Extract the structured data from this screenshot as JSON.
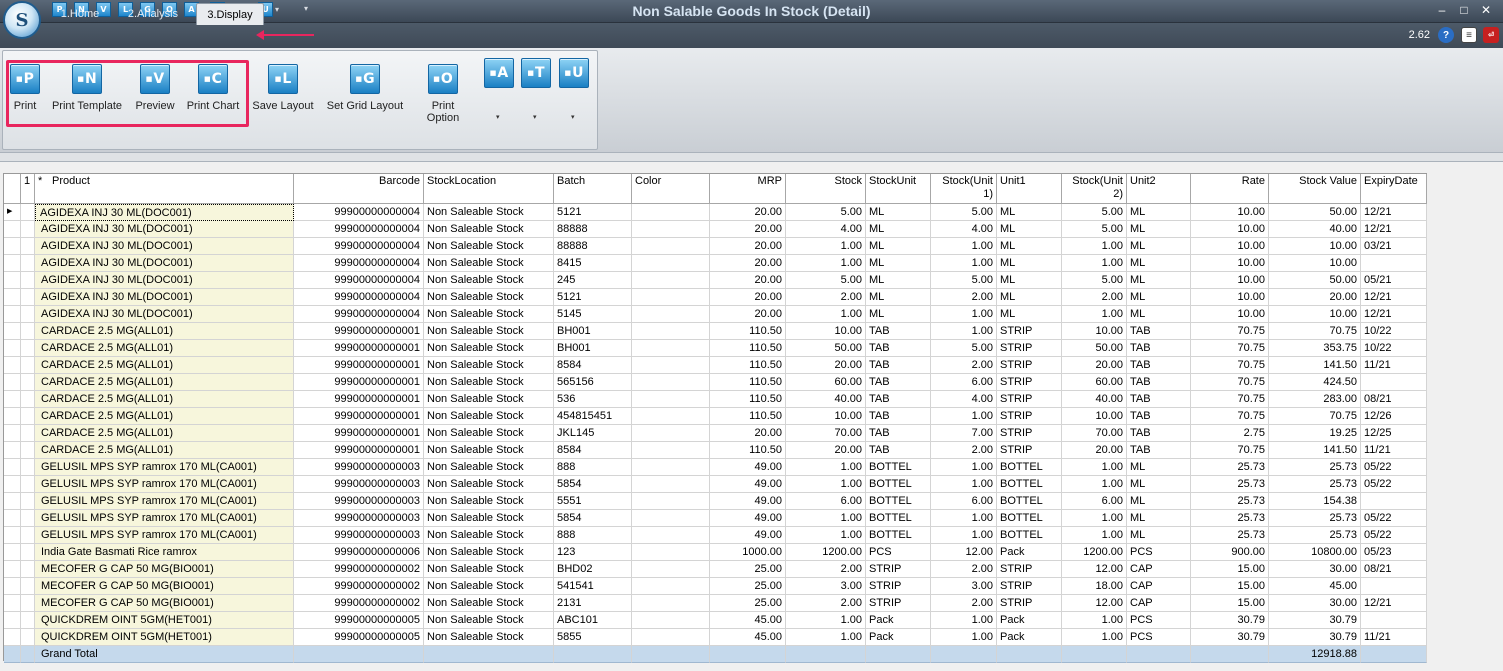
{
  "window": {
    "title": "Non Salable Goods In Stock (Detail)",
    "version": "2.62",
    "logo_letter": "S"
  },
  "quick_access": [
    {
      "letter": "P",
      "icon": "print-icon"
    },
    {
      "letter": "N",
      "icon": "template-icon"
    },
    {
      "letter": "V",
      "icon": "preview-icon"
    },
    {
      "letter": "L",
      "icon": "layout-icon"
    },
    {
      "letter": "G",
      "icon": "grid-icon"
    },
    {
      "letter": "O",
      "icon": "option-icon"
    },
    {
      "letter": "A",
      "icon": "a-icon"
    },
    {
      "letter": "T",
      "icon": "t-icon"
    },
    {
      "letter": "U",
      "icon": "u-icon"
    }
  ],
  "tabs": [
    "1.Home",
    "2.Analysis",
    "3.Display"
  ],
  "ribbon": [
    {
      "letter": "P",
      "label": "Print",
      "icon": "print-icon"
    },
    {
      "letter": "N",
      "label": "Print Template",
      "icon": "print-template-icon"
    },
    {
      "letter": "V",
      "label": "Preview",
      "icon": "preview-icon"
    },
    {
      "letter": "C",
      "label": "Print Chart",
      "icon": "print-chart-icon"
    },
    {
      "letter": "L",
      "label": "Save Layout",
      "icon": "save-layout-icon"
    },
    {
      "letter": "G",
      "label": "Set Grid Layout",
      "icon": "grid-layout-icon"
    },
    {
      "letter": "O",
      "label": "Print Option",
      "icon": "print-option-icon"
    },
    {
      "letter": "A",
      "label": "",
      "icon": "a-dropdown-icon"
    },
    {
      "letter": "T",
      "label": "",
      "icon": "t-dropdown-icon"
    },
    {
      "letter": "U",
      "label": "",
      "icon": "u-dropdown-icon"
    }
  ],
  "grid": {
    "corner": "1",
    "star": "*",
    "columns": [
      "Product",
      "Barcode",
      "StockLocation",
      "Batch",
      "Color",
      "MRP",
      "Stock",
      "StockUnit",
      "Stock(Unit 1)",
      "Unit1",
      "Stock(Unit 2)",
      "Unit2",
      "Rate",
      "Stock Value",
      "ExpiryDate"
    ],
    "rows": [
      [
        "AGIDEXA INJ 30 ML(DOC001)",
        "99900000000004",
        "Non Saleable Stock",
        "5121",
        "",
        "20.00",
        "5.00",
        "ML",
        "5.00",
        "ML",
        "5.00",
        "ML",
        "10.00",
        "50.00",
        "12/21"
      ],
      [
        "AGIDEXA INJ 30 ML(DOC001)",
        "99900000000004",
        "Non Saleable Stock",
        "88888",
        "",
        "20.00",
        "4.00",
        "ML",
        "4.00",
        "ML",
        "5.00",
        "ML",
        "10.00",
        "40.00",
        "12/21"
      ],
      [
        "AGIDEXA INJ 30 ML(DOC001)",
        "99900000000004",
        "Non Saleable Stock",
        "88888",
        "",
        "20.00",
        "1.00",
        "ML",
        "1.00",
        "ML",
        "1.00",
        "ML",
        "10.00",
        "10.00",
        "03/21"
      ],
      [
        "AGIDEXA INJ 30 ML(DOC001)",
        "99900000000004",
        "Non Saleable Stock",
        "8415",
        "",
        "20.00",
        "1.00",
        "ML",
        "1.00",
        "ML",
        "1.00",
        "ML",
        "10.00",
        "10.00",
        ""
      ],
      [
        "AGIDEXA INJ 30 ML(DOC001)",
        "99900000000004",
        "Non Saleable Stock",
        "245",
        "",
        "20.00",
        "5.00",
        "ML",
        "5.00",
        "ML",
        "5.00",
        "ML",
        "10.00",
        "50.00",
        "05/21"
      ],
      [
        "AGIDEXA INJ 30 ML(DOC001)",
        "99900000000004",
        "Non Saleable Stock",
        "5121",
        "",
        "20.00",
        "2.00",
        "ML",
        "2.00",
        "ML",
        "2.00",
        "ML",
        "10.00",
        "20.00",
        "12/21"
      ],
      [
        "AGIDEXA INJ 30 ML(DOC001)",
        "99900000000004",
        "Non Saleable Stock",
        "5145",
        "",
        "20.00",
        "1.00",
        "ML",
        "1.00",
        "ML",
        "1.00",
        "ML",
        "10.00",
        "10.00",
        "12/21"
      ],
      [
        "CARDACE 2.5 MG(ALL01)",
        "99900000000001",
        "Non Saleable Stock",
        "BH001",
        "",
        "110.50",
        "10.00",
        "TAB",
        "1.00",
        "STRIP",
        "10.00",
        "TAB",
        "70.75",
        "70.75",
        "10/22"
      ],
      [
        "CARDACE 2.5 MG(ALL01)",
        "99900000000001",
        "Non Saleable Stock",
        "BH001",
        "",
        "110.50",
        "50.00",
        "TAB",
        "5.00",
        "STRIP",
        "50.00",
        "TAB",
        "70.75",
        "353.75",
        "10/22"
      ],
      [
        "CARDACE 2.5 MG(ALL01)",
        "99900000000001",
        "Non Saleable Stock",
        "8584",
        "",
        "110.50",
        "20.00",
        "TAB",
        "2.00",
        "STRIP",
        "20.00",
        "TAB",
        "70.75",
        "141.50",
        "11/21"
      ],
      [
        "CARDACE 2.5 MG(ALL01)",
        "99900000000001",
        "Non Saleable Stock",
        "565156",
        "",
        "110.50",
        "60.00",
        "TAB",
        "6.00",
        "STRIP",
        "60.00",
        "TAB",
        "70.75",
        "424.50",
        ""
      ],
      [
        "CARDACE 2.5 MG(ALL01)",
        "99900000000001",
        "Non Saleable Stock",
        "536",
        "",
        "110.50",
        "40.00",
        "TAB",
        "4.00",
        "STRIP",
        "40.00",
        "TAB",
        "70.75",
        "283.00",
        "08/21"
      ],
      [
        "CARDACE 2.5 MG(ALL01)",
        "99900000000001",
        "Non Saleable Stock",
        "454815451",
        "",
        "110.50",
        "10.00",
        "TAB",
        "1.00",
        "STRIP",
        "10.00",
        "TAB",
        "70.75",
        "70.75",
        "12/26"
      ],
      [
        "CARDACE 2.5 MG(ALL01)",
        "99900000000001",
        "Non Saleable Stock",
        "JKL145",
        "",
        "20.00",
        "70.00",
        "TAB",
        "7.00",
        "STRIP",
        "70.00",
        "TAB",
        "2.75",
        "19.25",
        "12/25"
      ],
      [
        "CARDACE 2.5 MG(ALL01)",
        "99900000000001",
        "Non Saleable Stock",
        "8584",
        "",
        "110.50",
        "20.00",
        "TAB",
        "2.00",
        "STRIP",
        "20.00",
        "TAB",
        "70.75",
        "141.50",
        "11/21"
      ],
      [
        "GELUSIL MPS SYP ramrox 170 ML(CA001)",
        "99900000000003",
        "Non Saleable Stock",
        "888",
        "",
        "49.00",
        "1.00",
        "BOTTEL",
        "1.00",
        "BOTTEL",
        "1.00",
        "ML",
        "25.73",
        "25.73",
        "05/22"
      ],
      [
        "GELUSIL MPS SYP ramrox 170 ML(CA001)",
        "99900000000003",
        "Non Saleable Stock",
        "5854",
        "",
        "49.00",
        "1.00",
        "BOTTEL",
        "1.00",
        "BOTTEL",
        "1.00",
        "ML",
        "25.73",
        "25.73",
        "05/22"
      ],
      [
        "GELUSIL MPS SYP ramrox 170 ML(CA001)",
        "99900000000003",
        "Non Saleable Stock",
        "5551",
        "",
        "49.00",
        "6.00",
        "BOTTEL",
        "6.00",
        "BOTTEL",
        "6.00",
        "ML",
        "25.73",
        "154.38",
        ""
      ],
      [
        "GELUSIL MPS SYP ramrox 170 ML(CA001)",
        "99900000000003",
        "Non Saleable Stock",
        "5854",
        "",
        "49.00",
        "1.00",
        "BOTTEL",
        "1.00",
        "BOTTEL",
        "1.00",
        "ML",
        "25.73",
        "25.73",
        "05/22"
      ],
      [
        "GELUSIL MPS SYP ramrox 170 ML(CA001)",
        "99900000000003",
        "Non Saleable Stock",
        "888",
        "",
        "49.00",
        "1.00",
        "BOTTEL",
        "1.00",
        "BOTTEL",
        "1.00",
        "ML",
        "25.73",
        "25.73",
        "05/22"
      ],
      [
        "India Gate Basmati Rice ramrox",
        "99900000000006",
        "Non Saleable Stock",
        "123",
        "",
        "1000.00",
        "1200.00",
        "PCS",
        "12.00",
        "Pack",
        "1200.00",
        "PCS",
        "900.00",
        "10800.00",
        "05/23"
      ],
      [
        "MECOFER G CAP 50 MG(BIO001)",
        "99900000000002",
        "Non Saleable Stock",
        "BHD02",
        "",
        "25.00",
        "2.00",
        "STRIP",
        "2.00",
        "STRIP",
        "12.00",
        "CAP",
        "15.00",
        "30.00",
        "08/21"
      ],
      [
        "MECOFER G CAP 50 MG(BIO001)",
        "99900000000002",
        "Non Saleable Stock",
        "541541",
        "",
        "25.00",
        "3.00",
        "STRIP",
        "3.00",
        "STRIP",
        "18.00",
        "CAP",
        "15.00",
        "45.00",
        ""
      ],
      [
        "MECOFER G CAP 50 MG(BIO001)",
        "99900000000002",
        "Non Saleable Stock",
        "2131",
        "",
        "25.00",
        "2.00",
        "STRIP",
        "2.00",
        "STRIP",
        "12.00",
        "CAP",
        "15.00",
        "30.00",
        "12/21"
      ],
      [
        "QUICKDREM OINT 5GM(HET001)",
        "99900000000005",
        "Non Saleable Stock",
        "ABC101",
        "",
        "45.00",
        "1.00",
        "Pack",
        "1.00",
        "Pack",
        "1.00",
        "PCS",
        "30.79",
        "30.79",
        ""
      ],
      [
        "QUICKDREM OINT 5GM(HET001)",
        "99900000000005",
        "Non Saleable Stock",
        "5855",
        "",
        "45.00",
        "1.00",
        "Pack",
        "1.00",
        "Pack",
        "1.00",
        "PCS",
        "30.79",
        "30.79",
        "11/21"
      ]
    ],
    "total": {
      "label": "Grand Total",
      "stock_value": "12918.88"
    }
  }
}
